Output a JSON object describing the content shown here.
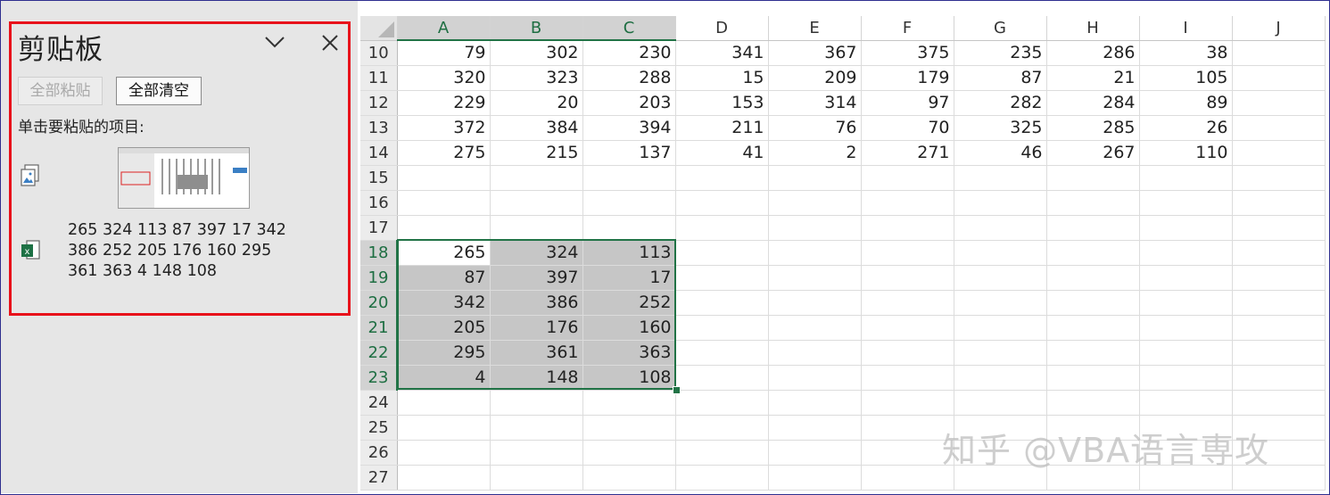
{
  "clipboard_pane": {
    "title": "剪贴板",
    "paste_all_label": "全部粘贴",
    "clear_all_label": "全部清空",
    "hint": "单击要粘贴的项目:",
    "text_item_lines": [
      "265 324 113 87 397 17 342",
      "386 252 205 176 160 295",
      "361 363 4 148 108"
    ]
  },
  "sheet": {
    "columns": [
      "A",
      "B",
      "C",
      "D",
      "E",
      "F",
      "G",
      "H",
      "I",
      "J"
    ],
    "selected_columns": [
      "A",
      "B",
      "C"
    ],
    "rows": [
      {
        "num": "10",
        "cells": [
          "79",
          "302",
          "230",
          "341",
          "367",
          "375",
          "235",
          "286",
          "38",
          ""
        ]
      },
      {
        "num": "11",
        "cells": [
          "320",
          "323",
          "288",
          "15",
          "209",
          "179",
          "87",
          "21",
          "105",
          ""
        ]
      },
      {
        "num": "12",
        "cells": [
          "229",
          "20",
          "203",
          "153",
          "314",
          "97",
          "282",
          "284",
          "89",
          ""
        ]
      },
      {
        "num": "13",
        "cells": [
          "372",
          "384",
          "394",
          "211",
          "76",
          "70",
          "325",
          "285",
          "26",
          ""
        ]
      },
      {
        "num": "14",
        "cells": [
          "275",
          "215",
          "137",
          "41",
          "2",
          "271",
          "46",
          "267",
          "110",
          ""
        ]
      },
      {
        "num": "15",
        "cells": [
          "",
          "",
          "",
          "",
          "",
          "",
          "",
          "",
          "",
          ""
        ]
      },
      {
        "num": "16",
        "cells": [
          "",
          "",
          "",
          "",
          "",
          "",
          "",
          "",
          "",
          ""
        ]
      },
      {
        "num": "17",
        "cells": [
          "",
          "",
          "",
          "",
          "",
          "",
          "",
          "",
          "",
          ""
        ]
      },
      {
        "num": "18",
        "cells": [
          "265",
          "324",
          "113",
          "",
          "",
          "",
          "",
          "",
          "",
          ""
        ]
      },
      {
        "num": "19",
        "cells": [
          "87",
          "397",
          "17",
          "",
          "",
          "",
          "",
          "",
          "",
          ""
        ]
      },
      {
        "num": "20",
        "cells": [
          "342",
          "386",
          "252",
          "",
          "",
          "",
          "",
          "",
          "",
          ""
        ]
      },
      {
        "num": "21",
        "cells": [
          "205",
          "176",
          "160",
          "",
          "",
          "",
          "",
          "",
          "",
          ""
        ]
      },
      {
        "num": "22",
        "cells": [
          "295",
          "361",
          "363",
          "",
          "",
          "",
          "",
          "",
          "",
          ""
        ]
      },
      {
        "num": "23",
        "cells": [
          "4",
          "148",
          "108",
          "",
          "",
          "",
          "",
          "",
          "",
          ""
        ]
      },
      {
        "num": "24",
        "cells": [
          "",
          "",
          "",
          "",
          "",
          "",
          "",
          "",
          "",
          ""
        ]
      },
      {
        "num": "25",
        "cells": [
          "",
          "",
          "",
          "",
          "",
          "",
          "",
          "",
          "",
          ""
        ]
      },
      {
        "num": "26",
        "cells": [
          "",
          "",
          "",
          "",
          "",
          "",
          "",
          "",
          "",
          ""
        ]
      },
      {
        "num": "27",
        "cells": [
          "",
          "",
          "",
          "",
          "",
          "",
          "",
          "",
          "",
          ""
        ]
      }
    ],
    "selected_rows": [
      "18",
      "19",
      "20",
      "21",
      "22",
      "23"
    ],
    "active_cell": "A18"
  },
  "watermark": "知乎 @VBA语言専攻",
  "colors": {
    "selection": "#217346",
    "pane_highlight": "#e8121b"
  }
}
